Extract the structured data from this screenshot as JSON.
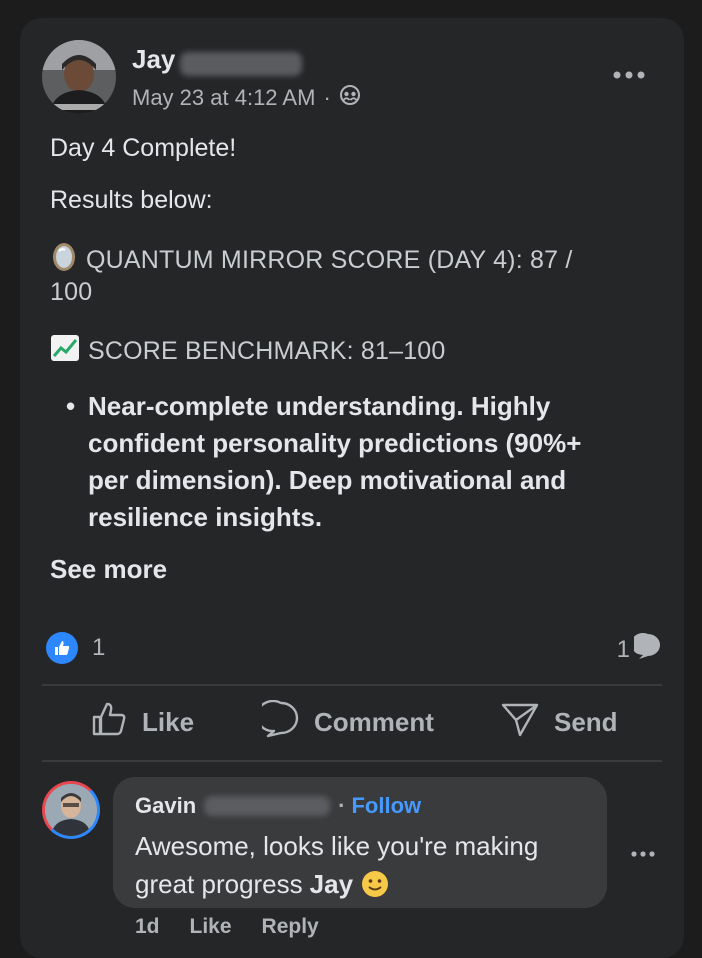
{
  "post": {
    "author_first": "Jay",
    "timestamp": "May 23 at 4:12 AM",
    "audience_sep": "·",
    "audience_icon": "friends-icon",
    "more_icon": "•••",
    "body": {
      "line1": "Day 4 Complete!",
      "line2": "Results below:",
      "score_emoji": "mirror-icon",
      "score_line_a": "QUANTUM MIRROR SCORE (DAY 4): 87 /",
      "score_line_b": "100",
      "bench_emoji": "chart-increasing-icon",
      "bench_line": "SCORE BENCHMARK: 81–100",
      "bullet_symbol": "•",
      "bullet_lines": [
        "Near-complete understanding. Highly",
        "confident personality predictions (90%+",
        "per dimension). Deep motivational and",
        "resilience insights."
      ],
      "see_more": "See more"
    },
    "reactions": {
      "like_count": "1",
      "comment_count": "1"
    },
    "actions": {
      "like": "Like",
      "comment": "Comment",
      "send": "Send"
    }
  },
  "comment": {
    "author_first": "Gavin",
    "dot": "·",
    "follow": "Follow",
    "text_line1": "Awesome, looks like you're making",
    "text_line2_a": "great progress",
    "text_line2_b": "Jay",
    "emoji": "slightly-smiling-face-icon",
    "more_icon": "•••",
    "time": "1d",
    "like": "Like",
    "reply": "Reply"
  },
  "colors": {
    "background": "#1c1c1d",
    "card": "#252628",
    "accent_blue": "#2d88ff",
    "follow_blue": "#4599ff",
    "secondary_text": "#b0b3b8"
  }
}
